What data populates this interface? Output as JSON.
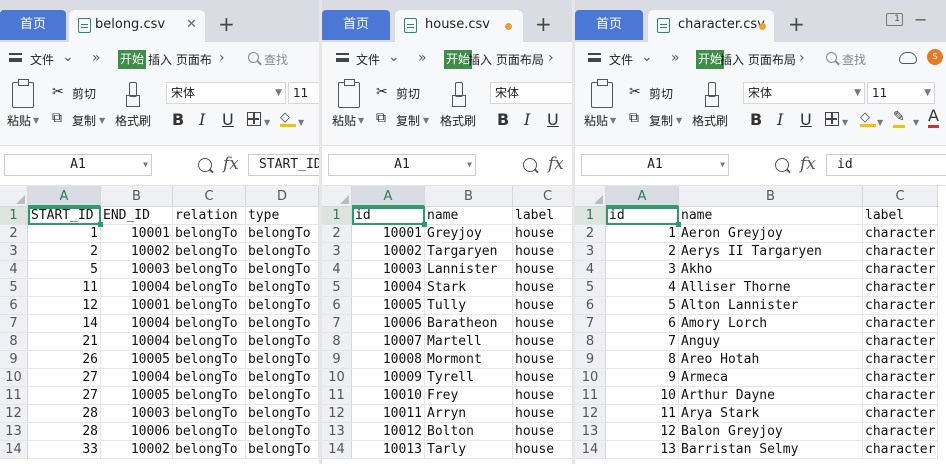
{
  "colors": {
    "accent": "#2a9d68",
    "tab_home": "#4a78d4",
    "start_button": "#3f8d4a",
    "unsaved_dot": "#e8a23b"
  },
  "windows": [
    {
      "home_tab": "首页",
      "file_tab": "belong.csv",
      "tab_state": "close",
      "toolbar": {
        "file_menu": "文件",
        "start": "开始",
        "insert_layout": "插入 页面布",
        "find": "查找",
        "paste": "粘贴",
        "cut": "剪切",
        "copy": "复制",
        "format_painter": "格式刷",
        "font": "宋体",
        "size": "11"
      },
      "name_box": "A1",
      "formula": "START_ID",
      "columns": [
        "A",
        "B",
        "C",
        "D"
      ],
      "rows": [
        [
          "START_ID",
          "END_ID",
          "relation",
          "type"
        ],
        [
          "1",
          "10001",
          "belongTo",
          "belongTo"
        ],
        [
          "2",
          "10002",
          "belongTo",
          "belongTo"
        ],
        [
          "5",
          "10003",
          "belongTo",
          "belongTo"
        ],
        [
          "11",
          "10004",
          "belongTo",
          "belongTo"
        ],
        [
          "12",
          "10001",
          "belongTo",
          "belongTo"
        ],
        [
          "14",
          "10004",
          "belongTo",
          "belongTo"
        ],
        [
          "21",
          "10004",
          "belongTo",
          "belongTo"
        ],
        [
          "26",
          "10005",
          "belongTo",
          "belongTo"
        ],
        [
          "27",
          "10004",
          "belongTo",
          "belongTo"
        ],
        [
          "27",
          "10005",
          "belongTo",
          "belongTo"
        ],
        [
          "28",
          "10003",
          "belongTo",
          "belongTo"
        ],
        [
          "28",
          "10006",
          "belongTo",
          "belongTo"
        ],
        [
          "33",
          "10002",
          "belongTo",
          "belongTo"
        ]
      ]
    },
    {
      "home_tab": "首页",
      "file_tab": "house.csv",
      "tab_state": "unsaved",
      "toolbar": {
        "file_menu": "文件",
        "start": "开始",
        "insert_layout": "插入 页面布局",
        "paste": "粘贴",
        "cut": "剪切",
        "copy": "复制",
        "format_painter": "格式刷",
        "font": "宋体"
      },
      "name_box": "A1",
      "formula": "",
      "columns": [
        "A",
        "B",
        "C"
      ],
      "rows": [
        [
          "id",
          "name",
          "label"
        ],
        [
          "10001",
          "Greyjoy",
          "house"
        ],
        [
          "10002",
          "Targaryen",
          "house"
        ],
        [
          "10003",
          "Lannister",
          "house"
        ],
        [
          "10004",
          "Stark",
          "house"
        ],
        [
          "10005",
          "Tully",
          "house"
        ],
        [
          "10006",
          "Baratheon",
          "house"
        ],
        [
          "10007",
          "Martell",
          "house"
        ],
        [
          "10008",
          "Mormont",
          "house"
        ],
        [
          "10009",
          "Tyrell",
          "house"
        ],
        [
          "10010",
          "Frey",
          "house"
        ],
        [
          "10011",
          "Arryn",
          "house"
        ],
        [
          "10012",
          "Bolton",
          "house"
        ],
        [
          "10013",
          "Tarly",
          "house"
        ]
      ]
    },
    {
      "home_tab": "首页",
      "file_tab": "character.csv",
      "tab_state": "unsaved",
      "toolbar": {
        "file_menu": "文件",
        "start": "开始",
        "insert_layout": "插入 页面布局",
        "find": "查找",
        "paste": "粘贴",
        "cut": "剪切",
        "copy": "复制",
        "format_painter": "格式刷",
        "font": "宋体",
        "size": "11",
        "dual_label": "1",
        "avatar_label": "S"
      },
      "name_box": "A1",
      "formula": "id",
      "columns": [
        "A",
        "B",
        "C"
      ],
      "rows": [
        [
          "id",
          "name",
          "label"
        ],
        [
          "1",
          "Aeron Greyjoy",
          "character"
        ],
        [
          "2",
          "Aerys II Targaryen",
          "character"
        ],
        [
          "3",
          "Akho",
          "character"
        ],
        [
          "4",
          "Alliser Thorne",
          "character"
        ],
        [
          "5",
          "Alton Lannister",
          "character"
        ],
        [
          "6",
          "Amory Lorch",
          "character"
        ],
        [
          "7",
          "Anguy",
          "character"
        ],
        [
          "8",
          "Areo Hotah",
          "character"
        ],
        [
          "9",
          "Armeca",
          "character"
        ],
        [
          "10",
          "Arthur Dayne",
          "character"
        ],
        [
          "11",
          "Arya Stark",
          "character"
        ],
        [
          "12",
          "Balon Greyjoy",
          "character"
        ],
        [
          "13",
          "Barristan Selmy",
          "character"
        ]
      ]
    }
  ]
}
